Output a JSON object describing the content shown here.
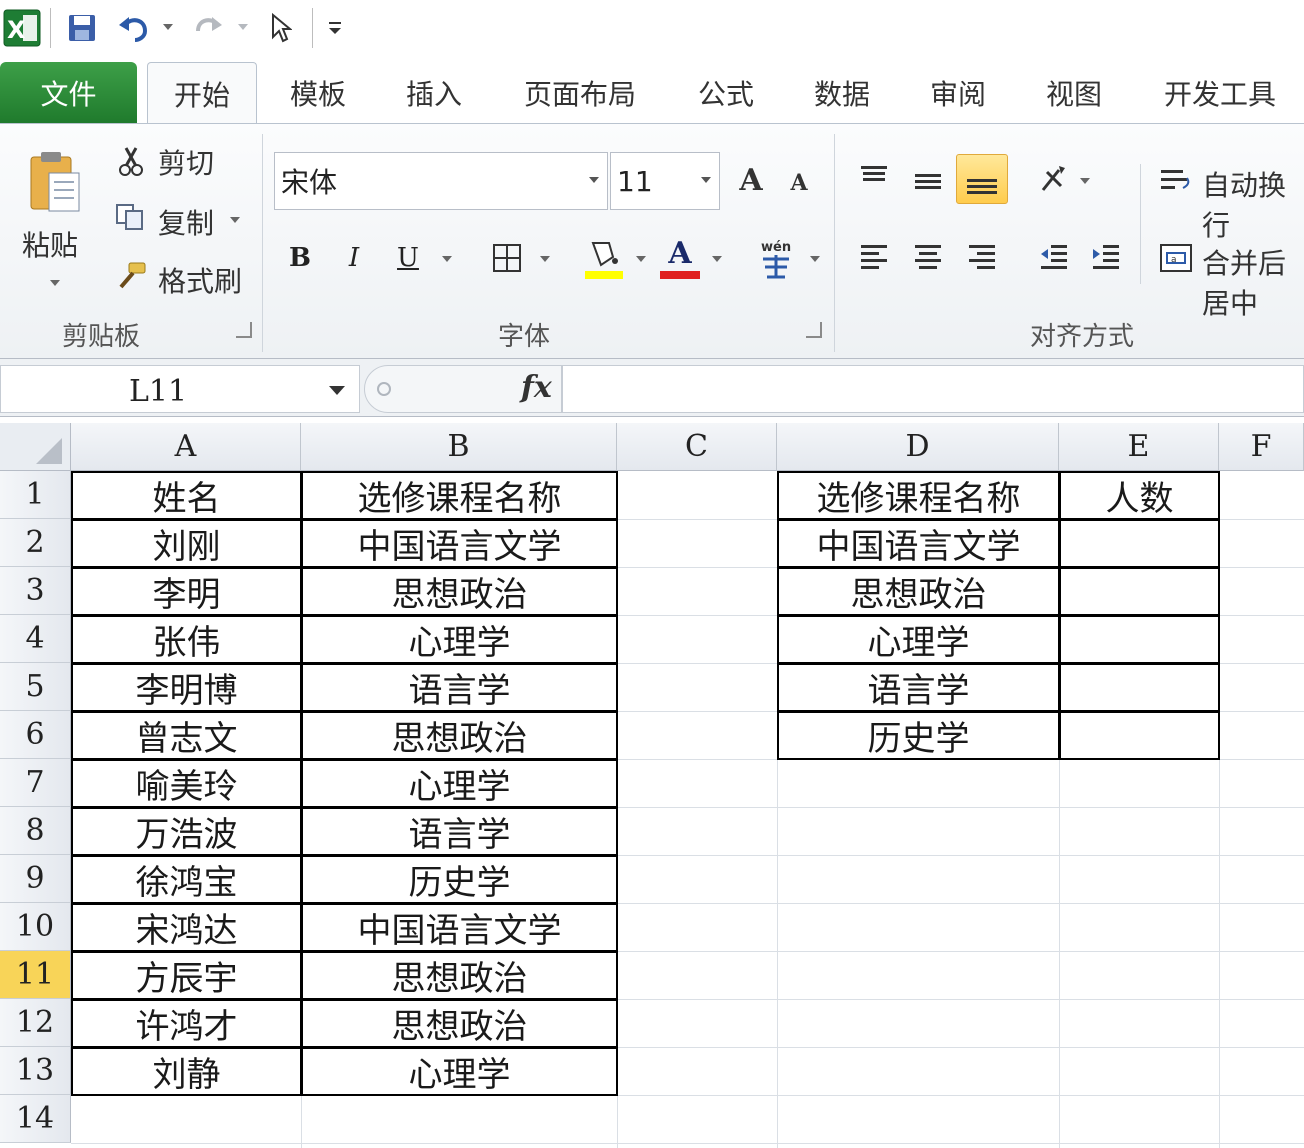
{
  "quick_access": {
    "app_icon": "excel-icon",
    "save_icon": "save-icon",
    "undo_icon": "undo-icon",
    "redo_icon": "redo-icon",
    "cursor_icon": "select-pointer-icon",
    "customize_icon": "customize-qat-icon"
  },
  "tabs": [
    {
      "label": "文件"
    },
    {
      "label": "开始"
    },
    {
      "label": "模板"
    },
    {
      "label": "插入"
    },
    {
      "label": "页面布局"
    },
    {
      "label": "公式"
    },
    {
      "label": "数据"
    },
    {
      "label": "审阅"
    },
    {
      "label": "视图"
    },
    {
      "label": "开发工具"
    }
  ],
  "ribbon": {
    "clipboard": {
      "paste": "粘贴",
      "cut": "剪切",
      "copy": "复制",
      "format_painter": "格式刷",
      "group_label": "剪贴板"
    },
    "font": {
      "font_name": "宋体",
      "font_size": "11",
      "bold": "B",
      "italic": "I",
      "underline": "U",
      "font_color_letter": "A",
      "group_label": "字体",
      "highlight_color": "#ffff00",
      "font_color": "#e02020"
    },
    "alignment": {
      "wrap_text": "自动换行",
      "merge_center": "合并后居中",
      "group_label": "对齐方式"
    }
  },
  "formula_bar": {
    "name_box": "L11",
    "fx_label": "fx",
    "formula": ""
  },
  "grid": {
    "columns": [
      "A",
      "B",
      "C",
      "D",
      "E",
      "F"
    ],
    "rows": [
      "1",
      "2",
      "3",
      "4",
      "5",
      "6",
      "7",
      "8",
      "9",
      "10",
      "11",
      "12",
      "13",
      "14"
    ],
    "selected_row": "11",
    "table1": [
      [
        "姓名",
        "选修课程名称"
      ],
      [
        "刘刚",
        "中国语言文学"
      ],
      [
        "李明",
        "思想政治"
      ],
      [
        "张伟",
        "心理学"
      ],
      [
        "李明博",
        "语言学"
      ],
      [
        "曾志文",
        "思想政治"
      ],
      [
        "喻美玲",
        "心理学"
      ],
      [
        "万浩波",
        "语言学"
      ],
      [
        "徐鸿宝",
        "历史学"
      ],
      [
        "宋鸿达",
        "中国语言文学"
      ],
      [
        "方辰宇",
        "思想政治"
      ],
      [
        "许鸿才",
        "思想政治"
      ],
      [
        "刘静",
        "心理学"
      ]
    ],
    "table2": [
      [
        "选修课程名称",
        "人数"
      ],
      [
        "中国语言文学",
        ""
      ],
      [
        "思想政治",
        ""
      ],
      [
        "心理学",
        ""
      ],
      [
        "语言学",
        ""
      ],
      [
        "历史学",
        ""
      ]
    ]
  }
}
